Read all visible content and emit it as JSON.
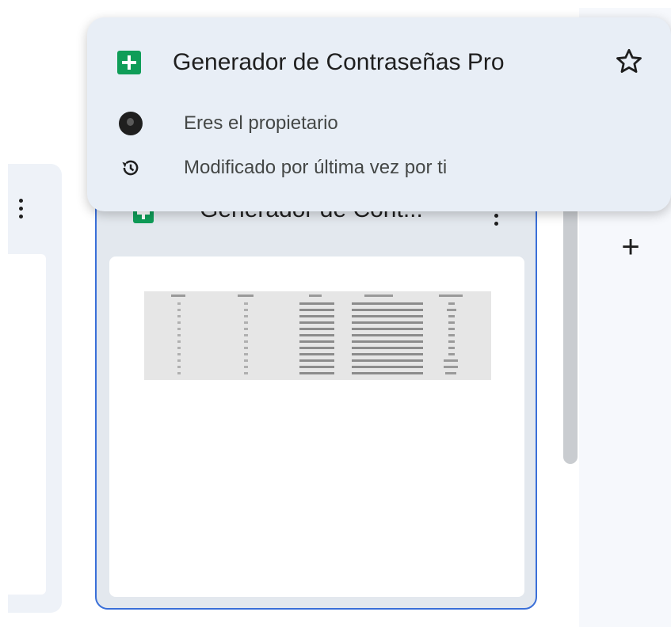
{
  "popup": {
    "title": "Generador de Contraseñas Pro",
    "owner_text": "Eres el propietario",
    "modified_text": "Modificado por última vez por ti"
  },
  "card": {
    "title": "Generador de Cont..."
  },
  "right_panel": {
    "add_label": "+"
  },
  "colors": {
    "sheets_green": "#0f9d58",
    "selection_border": "#3a6fd8",
    "card_bg": "#e3e8ee",
    "popup_bg": "#e8eef6"
  },
  "icons": [
    "sheets-icon",
    "star-icon",
    "avatar",
    "history-icon",
    "more-vert-icon",
    "plus-icon"
  ]
}
